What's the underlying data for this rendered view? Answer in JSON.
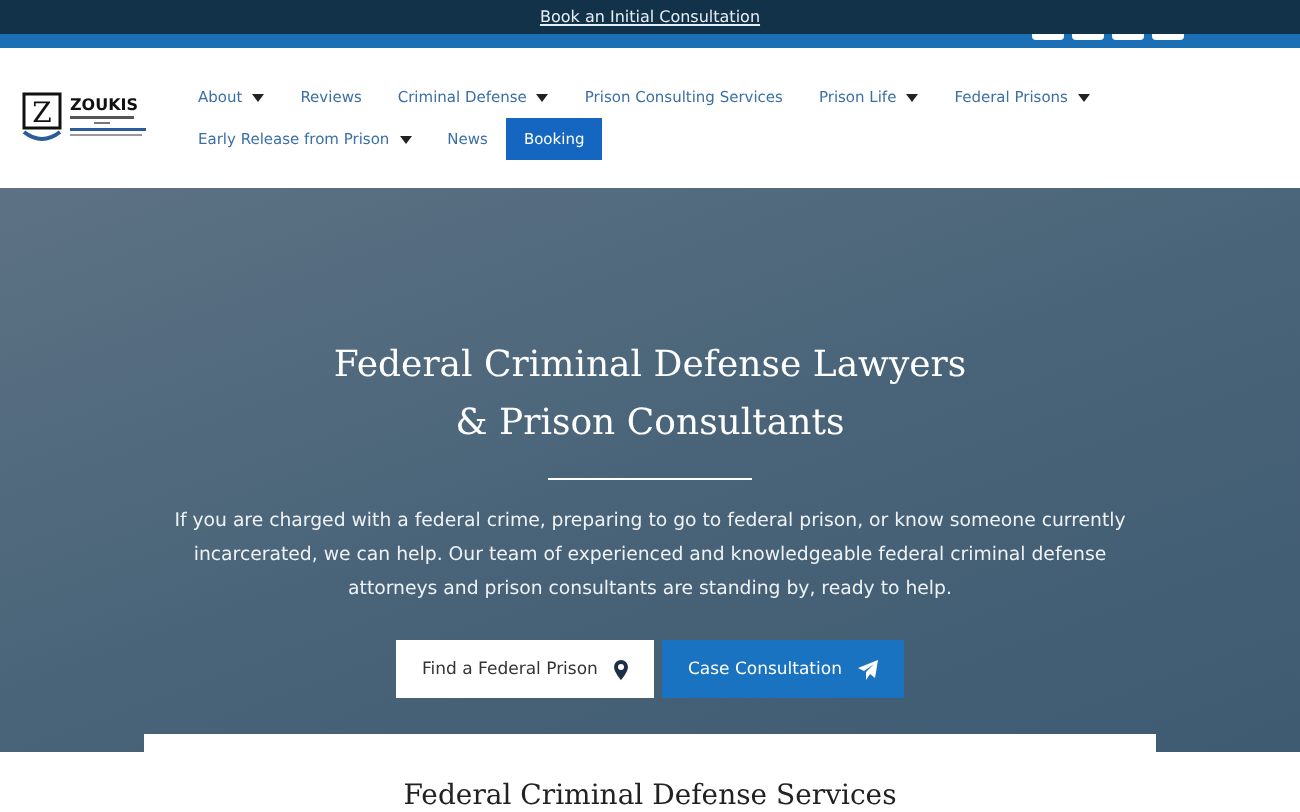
{
  "top_bar": {
    "link": "Book an Initial Consultation"
  },
  "logo": {
    "emblem": "Z",
    "name": "ZOUKIS"
  },
  "nav": {
    "items": [
      {
        "label": "About",
        "dropdown": true,
        "selected": false
      },
      {
        "label": "Reviews",
        "dropdown": false,
        "selected": false
      },
      {
        "label": "Criminal Defense",
        "dropdown": true,
        "selected": false
      },
      {
        "label": "Prison Consulting Services",
        "dropdown": false,
        "selected": false
      },
      {
        "label": "Prison Life",
        "dropdown": true,
        "selected": false
      },
      {
        "label": "Federal Prisons",
        "dropdown": true,
        "selected": false
      },
      {
        "label": "Early Release from Prison",
        "dropdown": true,
        "selected": false
      },
      {
        "label": "News",
        "dropdown": false,
        "selected": false
      },
      {
        "label": "Booking",
        "dropdown": false,
        "selected": true
      }
    ]
  },
  "hero": {
    "title_lines": [
      "Federal Criminal Defense Lawyers",
      "& Prison Consultants"
    ],
    "text": "If you are charged with a federal crime, preparing to go to federal prison, or know someone currently incarcerated, we can help. Our team of experienced and knowledgeable federal criminal defense attorneys and prison consultants are standing by, ready to help.",
    "buttons": [
      {
        "label": "Find a Federal Prison",
        "kind": "light"
      },
      {
        "label": "Case Consultation",
        "kind": "primary"
      }
    ]
  },
  "section": {
    "heading": "Federal Criminal Defense Services"
  }
}
